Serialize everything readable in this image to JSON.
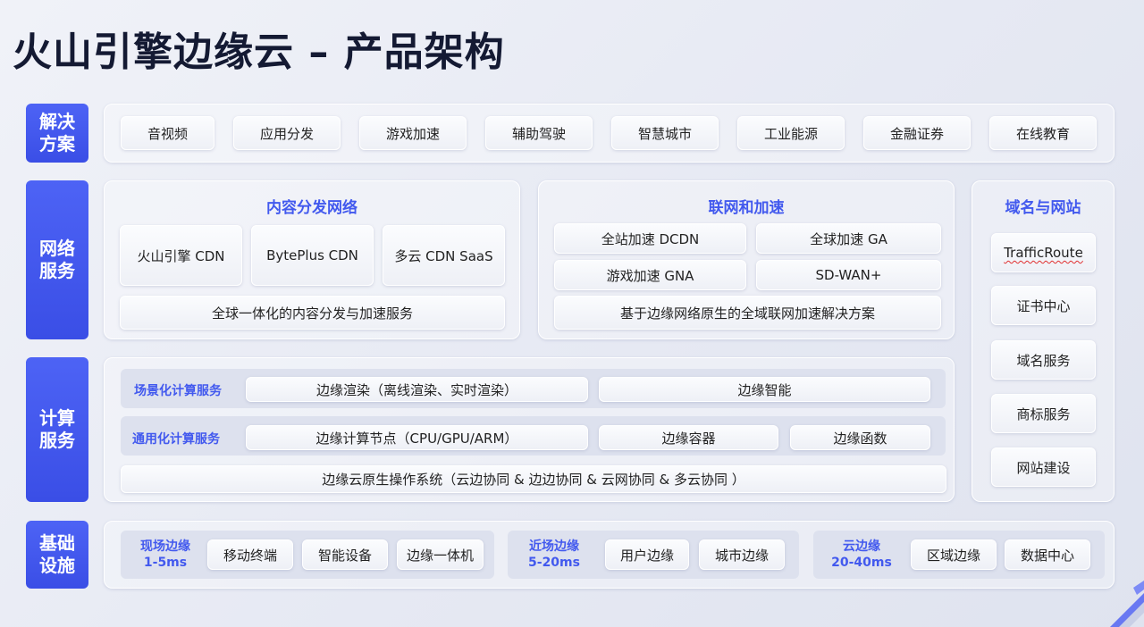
{
  "title": "火山引擎边缘云 – 产品架构",
  "rows": {
    "solutions": "解决方案",
    "network": "网络服务",
    "compute": "计算服务",
    "infra": "基础设施"
  },
  "solutions": [
    "音视频",
    "应用分发",
    "游戏加速",
    "辅助驾驶",
    "智慧城市",
    "工业能源",
    "金融证券",
    "在线教育"
  ],
  "cdn": {
    "heading": "内容分发网络",
    "items": [
      "火山引擎 CDN",
      "BytePlus CDN",
      "多云 CDN SaaS"
    ],
    "footer": "全球一体化的内容分发与加速服务"
  },
  "networking": {
    "heading": "联网和加速",
    "items": [
      "全站加速 DCDN",
      "全球加速 GA",
      "游戏加速 GNA",
      "SD-WAN+"
    ],
    "footer": "基于边缘网络原生的全域联网加速解决方案"
  },
  "domain": {
    "heading": "域名与网站",
    "items": [
      "TrafficRoute",
      "证书中心",
      "域名服务",
      "商标服务",
      "网站建设"
    ]
  },
  "compute": {
    "scenario": {
      "label": "场景化计算服务",
      "items": [
        "边缘渲染（离线渲染、实时渲染）",
        "边缘智能"
      ]
    },
    "general": {
      "label": "通用化计算服务",
      "items": [
        "边缘计算节点（CPU/GPU/ARM）",
        "边缘容器",
        "边缘函数"
      ]
    },
    "os": "边缘云原生操作系统（云边协同 & 边边协同 & 云网协同 & 多云协同 ）"
  },
  "infra": {
    "groups": [
      {
        "name": "现场边缘",
        "latency": "1-5ms",
        "items": [
          "移动终端",
          "智能设备",
          "边缘一体机"
        ]
      },
      {
        "name": "近场边缘",
        "latency": "5-20ms",
        "items": [
          "用户边缘",
          "城市边缘"
        ]
      },
      {
        "name": "云边缘",
        "latency": "20-40ms",
        "items": [
          "区域边缘",
          "数据中心"
        ]
      }
    ]
  },
  "colors": {
    "accent": "#4259ee",
    "label_bg": "#4459f0",
    "title": "#141a33"
  }
}
